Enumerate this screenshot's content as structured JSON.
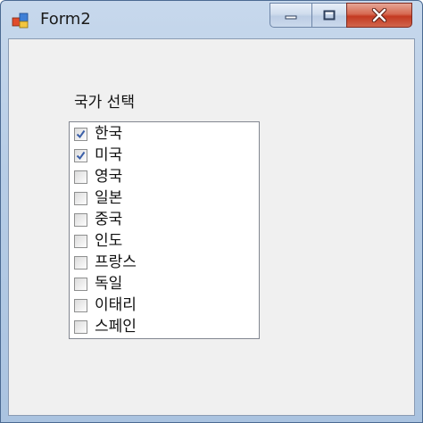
{
  "window": {
    "title": "Form2"
  },
  "group": {
    "label": "국가 선택"
  },
  "countries": [
    {
      "label": "한국",
      "checked": true
    },
    {
      "label": "미국",
      "checked": true
    },
    {
      "label": "영국",
      "checked": false
    },
    {
      "label": "일본",
      "checked": false
    },
    {
      "label": "중국",
      "checked": false
    },
    {
      "label": "인도",
      "checked": false
    },
    {
      "label": "프랑스",
      "checked": false
    },
    {
      "label": "독일",
      "checked": false
    },
    {
      "label": "이태리",
      "checked": false
    },
    {
      "label": "스페인",
      "checked": false
    }
  ],
  "colors": {
    "check": "#3b5fa8",
    "close_button": "#c94a33"
  }
}
